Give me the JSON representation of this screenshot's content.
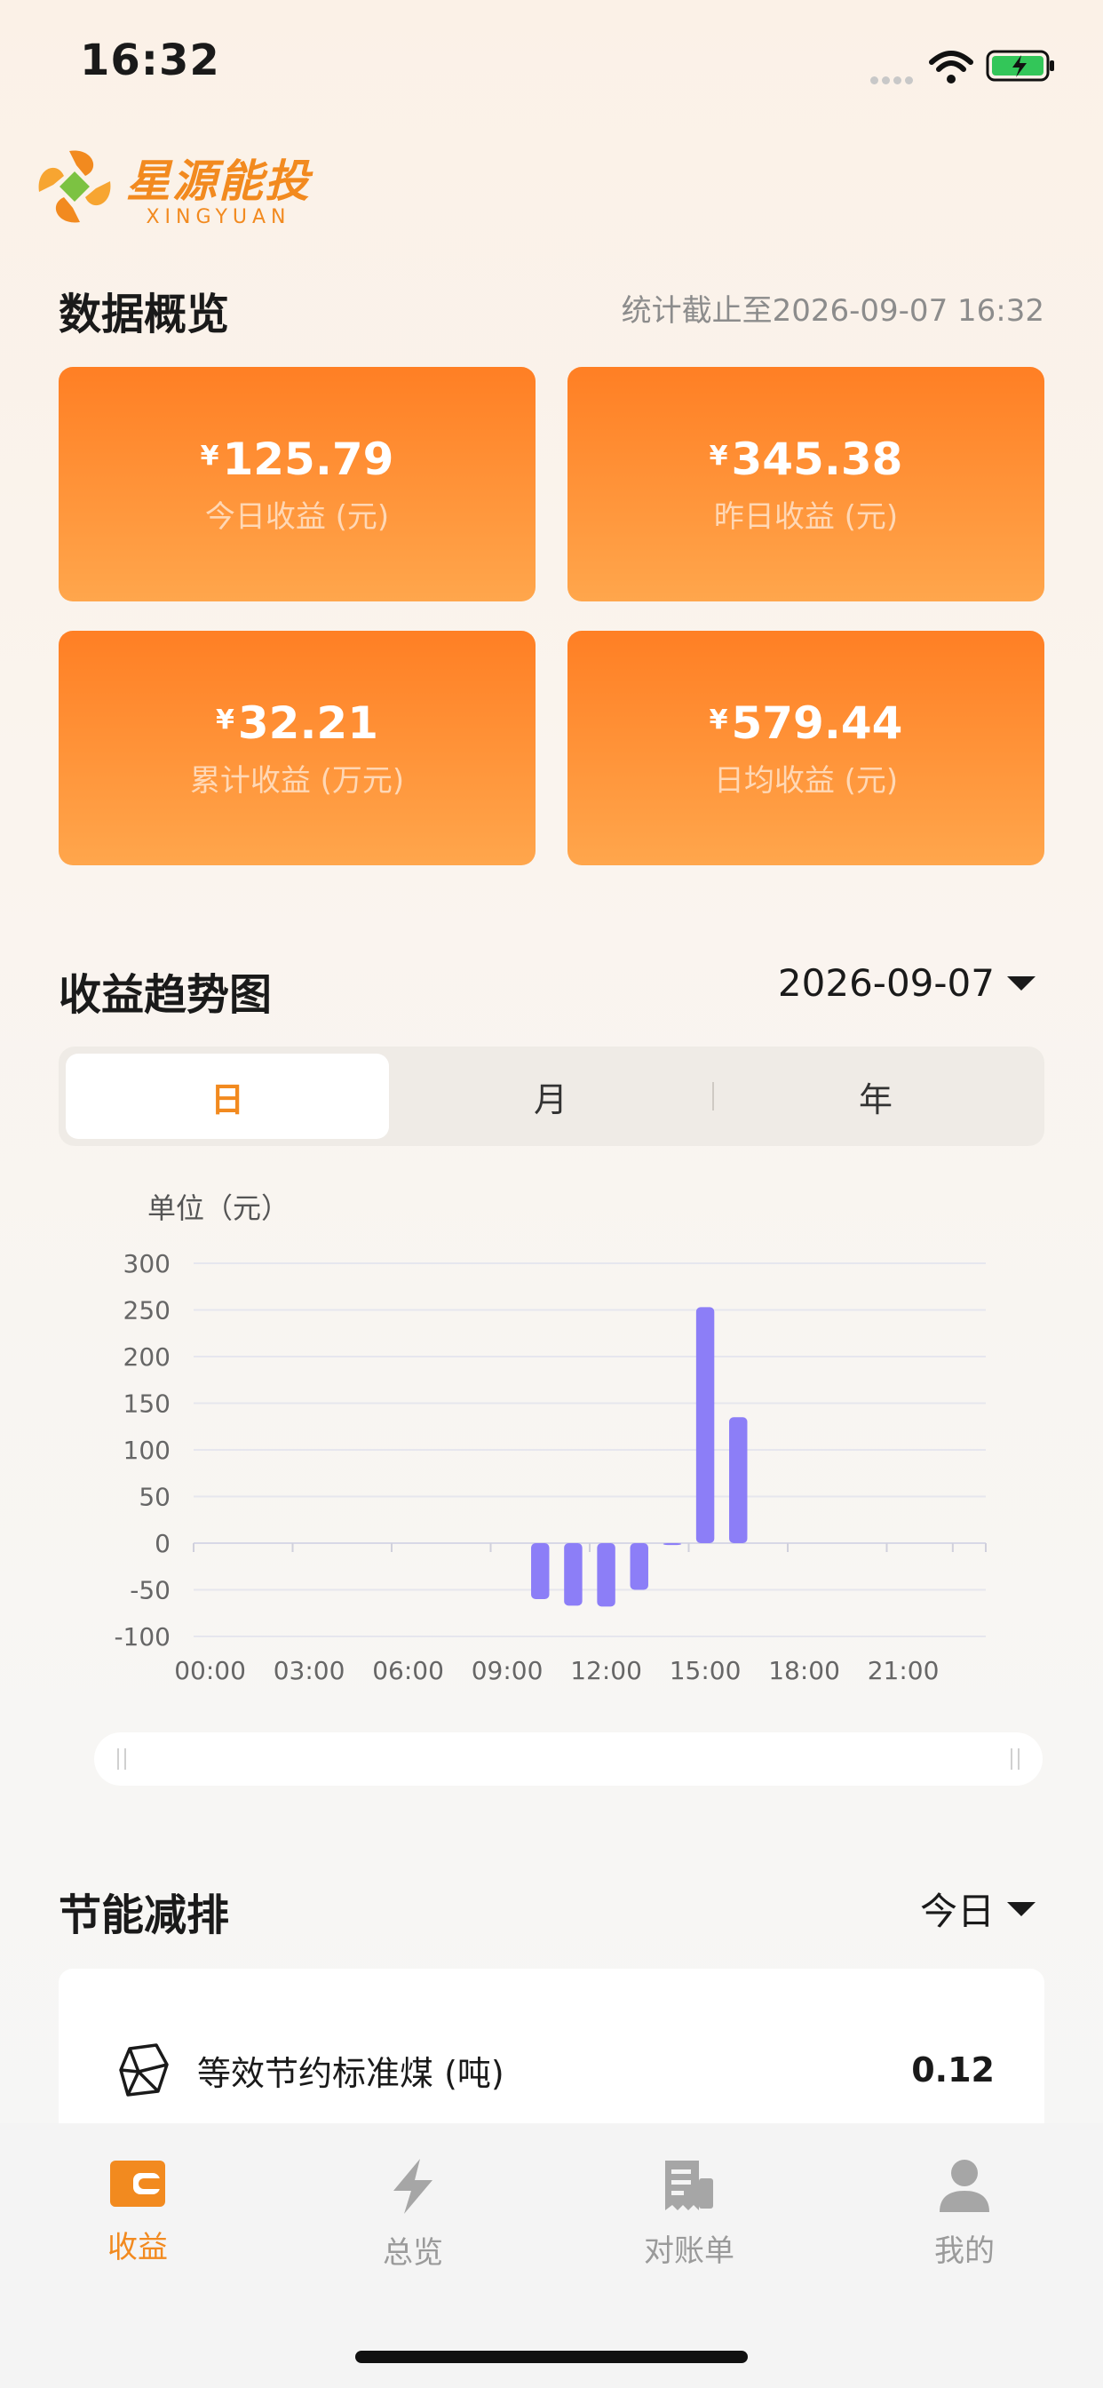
{
  "status": {
    "time": "16:32"
  },
  "logo": {
    "cn": "星源能投",
    "en": "XINGYUAN"
  },
  "overview": {
    "title": "数据概览",
    "timestamp": "统计截止至2026-09-07 16:32",
    "currency": "¥",
    "cards": [
      {
        "value": "125.79",
        "label": "今日收益 (元)"
      },
      {
        "value": "345.38",
        "label": "昨日收益 (元)"
      },
      {
        "value": "32.21",
        "label": "累计收益 (万元)"
      },
      {
        "value": "579.44",
        "label": "日均收益 (元)"
      }
    ]
  },
  "trend": {
    "title": "收益趋势图",
    "date": "2026-09-07",
    "tabs": [
      "日",
      "月",
      "年"
    ],
    "active_tab": 0
  },
  "chart_data": {
    "type": "bar",
    "unit_label": "单位（元）",
    "x": [
      "00:00",
      "01:00",
      "02:00",
      "03:00",
      "04:00",
      "05:00",
      "06:00",
      "07:00",
      "08:00",
      "09:00",
      "10:00",
      "11:00",
      "12:00",
      "13:00",
      "14:00",
      "15:00",
      "16:00",
      "17:00",
      "18:00",
      "19:00",
      "20:00",
      "21:00",
      "22:00",
      "23:00"
    ],
    "tick_labels": [
      "00:00",
      "03:00",
      "06:00",
      "09:00",
      "12:00",
      "15:00",
      "18:00",
      "21:00"
    ],
    "values": [
      0,
      0,
      0,
      0,
      0,
      0,
      0,
      0,
      0,
      0,
      -60,
      -67,
      -68,
      -50,
      -2,
      253,
      135,
      0,
      0,
      0,
      0,
      0,
      0,
      0
    ],
    "yticks": [
      300,
      250,
      200,
      150,
      100,
      50,
      0,
      -50,
      -100
    ],
    "ylim": [
      -100,
      300
    ],
    "grid": true,
    "bar_color": "#8c7ef7"
  },
  "energy": {
    "title": "节能减排",
    "period": "今日",
    "items": [
      {
        "label": "等效节约标准煤 (吨)",
        "value": "0.12",
        "icon": "coal-icon"
      }
    ]
  },
  "tabbar": {
    "items": [
      {
        "label": "收益",
        "icon": "wallet-icon"
      },
      {
        "label": "总览",
        "icon": "lightning-icon"
      },
      {
        "label": "对账单",
        "icon": "receipt-icon"
      },
      {
        "label": "我的",
        "icon": "user-icon"
      }
    ],
    "active": 0
  },
  "colors": {
    "accent": "#f28a1f",
    "card_top": "#ff7f24",
    "card_bottom": "#ffa64c",
    "bar": "#8c7ef7"
  }
}
